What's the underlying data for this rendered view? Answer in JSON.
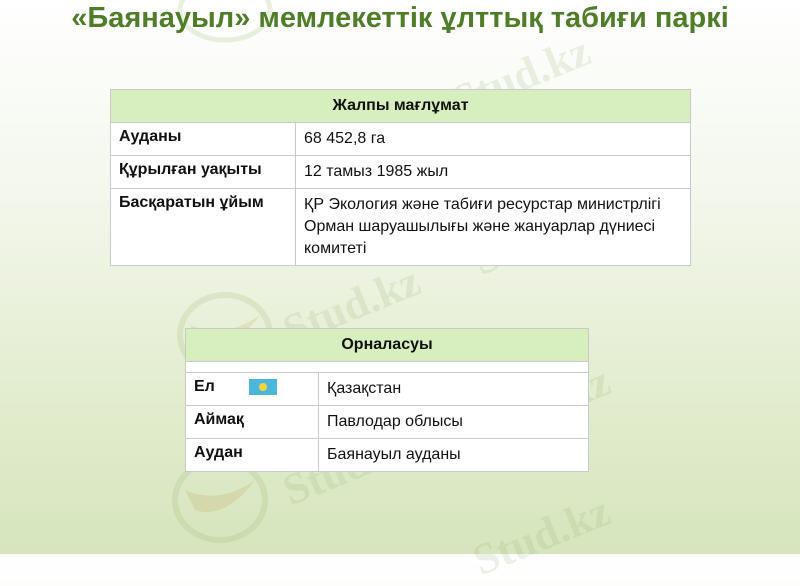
{
  "title": "«Баянауыл» мемлекеттік ұлттық табиғи паркі",
  "watermark": "Stud.kz",
  "general": {
    "header": "Жалпы мағлұмат",
    "rows": [
      {
        "key": "Ауданы",
        "value": "68 452,8 га"
      },
      {
        "key": "Құрылған уақыты",
        "value": "12 тамыз 1985 жыл"
      },
      {
        "key": "Басқаратын ұйым",
        "value": "ҚР Экология және табиғи ресурстар министрлігі Орман шаруашылығы және жануарлар дүниесі комитеті"
      }
    ]
  },
  "location": {
    "header": "Орналасуы",
    "rows": [
      {
        "key": "Ел",
        "value": "Қазақстан"
      },
      {
        "key": "Аймақ",
        "value": "Павлодар облысы"
      },
      {
        "key": "Аудан",
        "value": "Баянауыл ауданы"
      }
    ]
  },
  "colors": {
    "title": "#4f7d28",
    "table_header": "#d7eebf"
  }
}
